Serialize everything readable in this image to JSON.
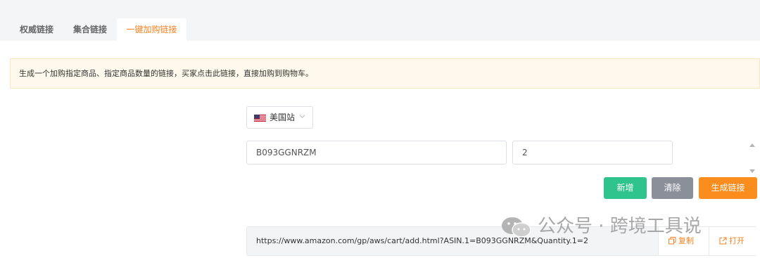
{
  "tabs": [
    {
      "label": "权威链接",
      "active": false
    },
    {
      "label": "集合链接",
      "active": false
    },
    {
      "label": "一键加购链接",
      "active": true
    }
  ],
  "notice": "生成一个加购指定商品、指定商品数量的链接，买家点击此链接，直接加购到购物车。",
  "site_select": {
    "label": "美国站",
    "flag": "us-flag-icon"
  },
  "asin_input": {
    "value": "B093GGNRZM"
  },
  "quantity_input": {
    "value": "2"
  },
  "buttons": {
    "add": "新增",
    "clear": "清除",
    "generate": "生成链接"
  },
  "result": {
    "url": "https://www.amazon.com/gp/aws/cart/add.html?ASIN.1=B093GGNRZM&Quantity.1=2",
    "copy": "复制",
    "open": "打开"
  },
  "watermark": "公众号 · 跨境工具说",
  "colors": {
    "accent": "#f7801f",
    "add": "#2fc38d",
    "clear": "#8a8f99",
    "generate": "#fb8c1e"
  }
}
